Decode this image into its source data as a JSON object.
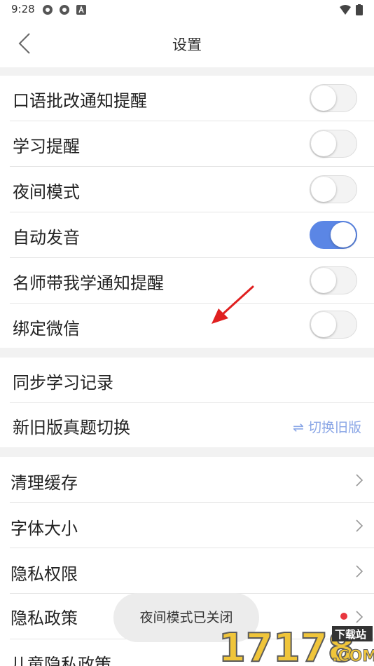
{
  "status_bar": {
    "time": "9:28"
  },
  "header": {
    "title": "设置"
  },
  "toggles": [
    {
      "label": "口语批改通知提醒",
      "on": false
    },
    {
      "label": "学习提醒",
      "on": false
    },
    {
      "label": "夜间模式",
      "on": false
    },
    {
      "label": "自动发音",
      "on": true
    },
    {
      "label": "名师带我学通知提醒",
      "on": false
    },
    {
      "label": "绑定微信",
      "on": false
    }
  ],
  "sync": {
    "sync_label": "同步学习记录",
    "version_label": "新旧版真题切换",
    "switch_old_label": "⇌ 切换旧版"
  },
  "menu": [
    {
      "label": "清理缓存"
    },
    {
      "label": "字体大小"
    },
    {
      "label": "隐私权限"
    },
    {
      "label": "隐私政策",
      "dot": true
    },
    {
      "label": "儿童隐私政策"
    }
  ],
  "toast": "夜间模式已关闭",
  "watermark": {
    "number": "17178",
    "tag": "下载站",
    "suffix": ".COM"
  },
  "colors": {
    "toggle_on": "#5b86e5",
    "dot": "#e8373f",
    "arrow": "#e02020"
  }
}
